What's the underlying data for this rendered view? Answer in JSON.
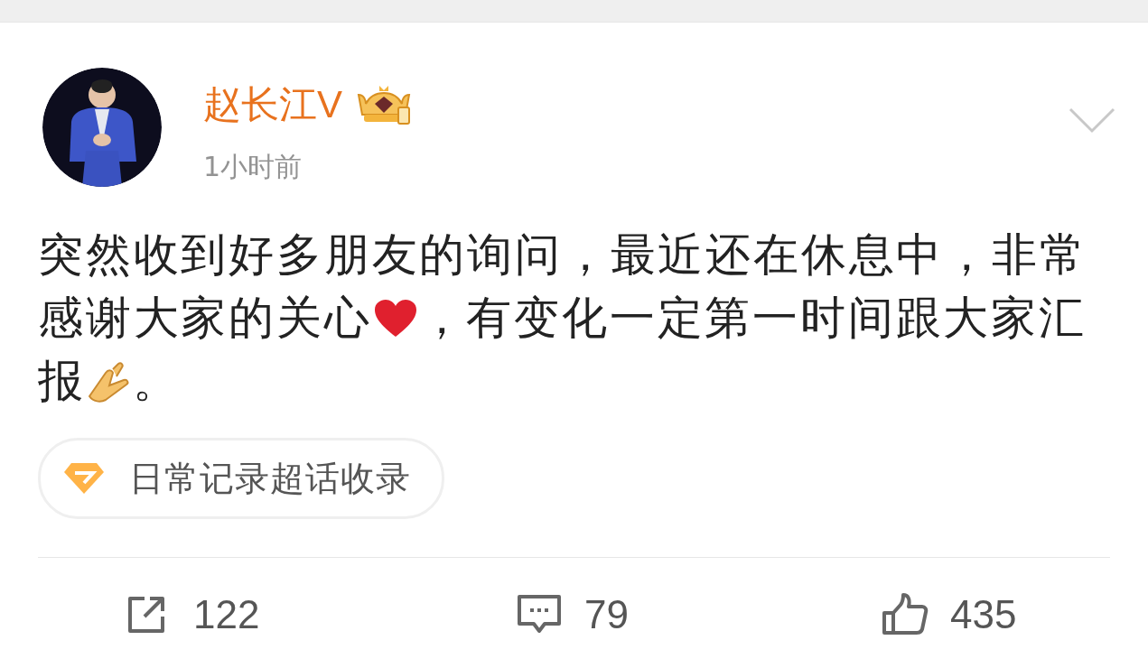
{
  "post": {
    "author": "赵长江V",
    "time": "1小时前",
    "body_parts": [
      "突然收到好多朋友的询问，最近还在休息中，非常感谢大家的关心",
      "，有变化一定第一时间跟大家汇报",
      "。"
    ],
    "topic_tag": "日常记录超话收录"
  },
  "actions": [
    {
      "kind": "repost",
      "count": "122"
    },
    {
      "kind": "comment",
      "count": "79"
    },
    {
      "kind": "like",
      "count": "435"
    }
  ]
}
